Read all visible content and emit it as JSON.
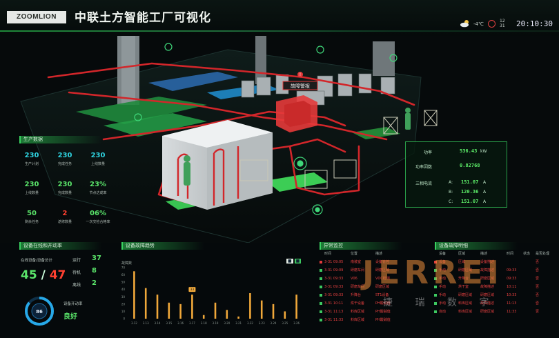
{
  "header": {
    "logo_text": "ZOOMLION",
    "title": "中联土方智能工厂可视化",
    "temperature": "-4℃",
    "date": "12 31",
    "clock": "20:10:30"
  },
  "scene": {
    "tag_label": "故障警报",
    "tag_badge": "!"
  },
  "production": {
    "title": "生产数据",
    "stats": [
      {
        "value": "230",
        "label": "生产计划",
        "color": "cyan"
      },
      {
        "value": "230",
        "label": "完成任务",
        "color": "cyan"
      },
      {
        "value": "230",
        "label": "上线数量",
        "color": "cyan"
      },
      {
        "value": "230",
        "label": "上线数量",
        "color": "green"
      },
      {
        "value": "230",
        "label": "完成数量",
        "color": "green"
      },
      {
        "value": "23%",
        "label": "节点达成率",
        "color": "green"
      },
      {
        "value": "50",
        "label": "剩余任务",
        "color": "green"
      },
      {
        "value": "2",
        "label": "返修数量",
        "color": "red"
      },
      {
        "value": "06%",
        "label": "一次交检合格率",
        "color": "green"
      }
    ]
  },
  "power": {
    "power_label": "功率",
    "power_value": "536.43",
    "power_unit": "kW",
    "factor_label": "功率因数",
    "factor_value": "0.82768",
    "current_label": "三相电流",
    "phases": [
      {
        "name": "A:",
        "value": "151.07",
        "unit": "A",
        "color": "red"
      },
      {
        "name": "B:",
        "value": "120.36",
        "unit": "A",
        "color": "green"
      },
      {
        "name": "C:",
        "value": "151.07",
        "unit": "A",
        "color": "green"
      }
    ]
  },
  "equipment_online": {
    "title": "设备在线和开动率",
    "label": "在线设备/设备总计",
    "online": "45",
    "total": "47",
    "running_label": "运行",
    "running_value": "37",
    "standby_label": "待机",
    "standby_value": "8",
    "offline_label": "离线",
    "offline_value": "2",
    "gauge_value": "86",
    "gauge_caption": "设备开动率",
    "status_value": "良好"
  },
  "fault_trend": {
    "title": "设备故障趋势",
    "ylabel": "故障数",
    "legend": [
      "■",
      "■"
    ]
  },
  "chart_data": {
    "type": "bar",
    "title": "设备故障趋势",
    "ylabel": "故障数",
    "ylim": [
      0,
      70
    ],
    "yticks": [
      "0",
      "10",
      "20",
      "30",
      "40",
      "50",
      "60",
      "70"
    ],
    "categories": [
      "3.12",
      "3.13",
      "3.14",
      "3.15",
      "3.16",
      "3.17",
      "3.18",
      "3.19",
      "3.20",
      "3.21",
      "3.22",
      "3.23",
      "3.24",
      "3.25",
      "3.26"
    ],
    "values": [
      65,
      42,
      33,
      22,
      20,
      33,
      5,
      22,
      12,
      3,
      35,
      25,
      20,
      10,
      33
    ],
    "highlight_index": 5,
    "highlight_label": "33"
  },
  "alarms": {
    "title": "异常监控",
    "headers": [
      "时间",
      "位置",
      "描述",
      "",
      "",
      ""
    ],
    "rows": [
      {
        "time": "3-31 09:05",
        "loc": "南装室",
        "desc": "设备管控"
      },
      {
        "time": "3-31 09:09",
        "loc": "研磨车间",
        "desc": "研磨区域"
      },
      {
        "time": "3-31 09:33",
        "loc": "V06",
        "desc": "VOC检测"
      },
      {
        "time": "3-31 09:33",
        "loc": "研磨车间",
        "desc": "研磨区域"
      },
      {
        "time": "3-31 09:33",
        "loc": "升降台",
        "desc": "ST1设备"
      },
      {
        "time": "3-31 10:11",
        "loc": "烘干设备",
        "desc": "PH酸碱值"
      },
      {
        "time": "3-31 11:13",
        "loc": "料库区域",
        "desc": "PH酸碱值"
      },
      {
        "time": "3-31 11:33",
        "loc": "料库区域",
        "desc": "PH酸碱值"
      }
    ]
  },
  "fault_info": {
    "title": "设备故障明细",
    "headers": [
      "设备",
      "区域",
      "描述",
      "时间",
      "状态",
      "是否处理"
    ],
    "rows": [
      {
        "dev": "设备",
        "area": "区域",
        "desc": "设备描述",
        "time": "",
        "state": "",
        "handled": "否"
      },
      {
        "dev": "手动",
        "area": "研磨区域",
        "desc": "故障描述",
        "time": "09:33",
        "state": "",
        "handled": "否"
      },
      {
        "dev": "手动",
        "area": "升降台",
        "desc": "研磨区域",
        "time": "09:33",
        "state": "",
        "handled": "否"
      },
      {
        "dev": "手动",
        "area": "烘干室",
        "desc": "故障描述",
        "time": "10:11",
        "state": "",
        "handled": "否"
      },
      {
        "dev": "手动",
        "area": "研磨区域",
        "desc": "研磨区域",
        "time": "10:33",
        "state": "",
        "handled": "否"
      },
      {
        "dev": "手动",
        "area": "料库区域",
        "desc": "故障描述",
        "time": "11:13",
        "state": "",
        "handled": "否"
      },
      {
        "dev": "自动",
        "area": "料库区域",
        "desc": "研磨区域",
        "time": "11:33",
        "state": "",
        "handled": "否"
      }
    ]
  },
  "watermark": {
    "text": "JERREI",
    "sub": "捷 瑞 数 字"
  }
}
